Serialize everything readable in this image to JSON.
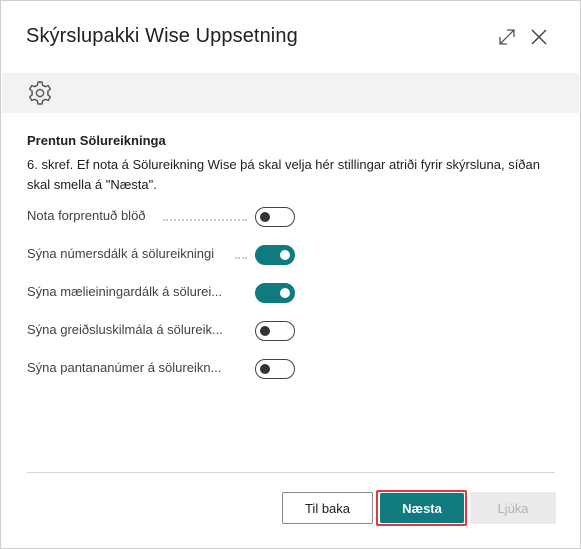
{
  "dialog": {
    "title": "Skýrslupakki Wise Uppsetning",
    "icons": {
      "expand": "expand-icon",
      "close": "close-icon",
      "settings": "gear-icon"
    }
  },
  "section": {
    "title": "Prentun Sölureikninga",
    "instructions": "6. skref. Ef nota á Sölureikning Wise þá skal velja hér stillingar atriði fyrir skýrsluna, síðan skal smella á \"Næsta\"."
  },
  "fields": [
    {
      "label": "Nota forprentuð blöð",
      "value": false
    },
    {
      "label": "Sýna númersdálk á sölureikningi",
      "value": true
    },
    {
      "label": "Sýna mælieiningardálk á sölurei...",
      "value": true
    },
    {
      "label": "Sýna greiðsluskilmála á sölureik...",
      "value": false
    },
    {
      "label": "Sýna pantananúmer á sölureikn...",
      "value": false
    }
  ],
  "footer": {
    "back_label": "Til baka",
    "next_label": "Næsta",
    "finish_label": "Ljúka"
  },
  "colors": {
    "accent": "#0f7b7f",
    "highlight_border": "#e0393e",
    "action_bar": "#f2f2f2"
  }
}
